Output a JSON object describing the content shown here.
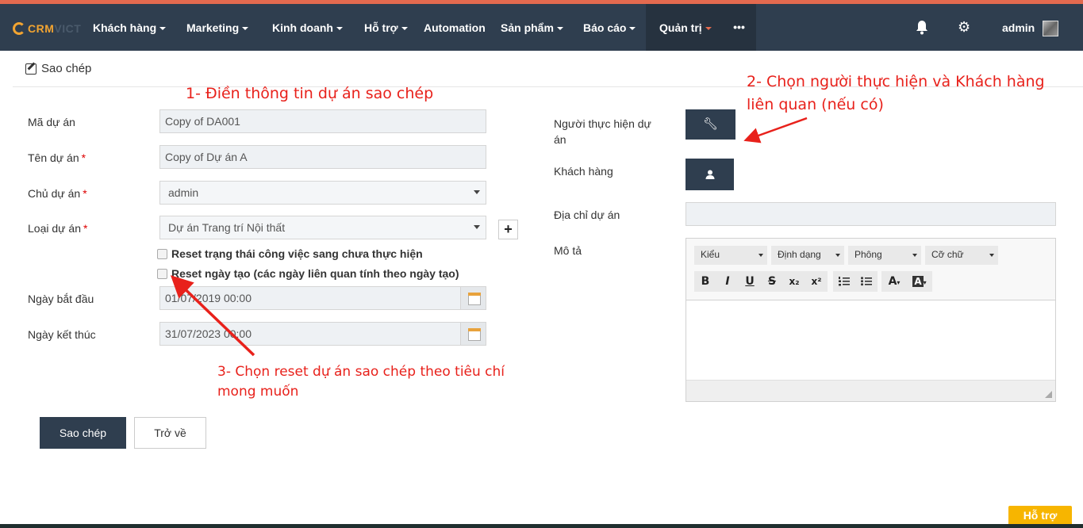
{
  "nav": {
    "logo_a": "CRM",
    "logo_b": "VICT",
    "items": [
      "Khách hàng",
      "Marketing",
      "Kinh doanh",
      "Hỗ trợ",
      "Automation",
      "Sản phẩm",
      "Báo cáo",
      "Quản trị"
    ],
    "more": "•••",
    "user": "admin"
  },
  "page": {
    "title": "Sao chép"
  },
  "form": {
    "code_label": "Mã dự án",
    "code_value": "Copy of DA001",
    "name_label": "Tên dự án",
    "name_value": "Copy of Dự án A",
    "owner_label": "Chủ dự án",
    "owner_value": "admin",
    "type_label": "Loại dự án",
    "type_value": "Dự án Trang trí Nội thất",
    "required_mark": "*",
    "reset_status_label": "Reset trạng thái công việc sang chưa thực hiện",
    "reset_date_label": "Reset ngày tạo (các ngày liên quan tính theo ngày tạo)",
    "start_label": "Ngày bắt đầu",
    "start_value": "01/07/2019 00:00",
    "end_label": "Ngày kết thúc",
    "end_value": "31/07/2023 00:00",
    "assignee_label": "Người thực hiện dự án",
    "customer_label": "Khách hàng",
    "address_label": "Địa chỉ dự án",
    "address_value": "",
    "desc_label": "Mô tả"
  },
  "editor": {
    "style": "Kiểu",
    "format": "Định dạng",
    "font": "Phông",
    "size": "Cỡ chữ",
    "buttons": [
      "B",
      "I",
      "U",
      "S",
      "x₂",
      "x²"
    ]
  },
  "actions": {
    "submit": "Sao chép",
    "back": "Trở về"
  },
  "annotations": {
    "a1": "1- Điền thông tin dự án sao chép",
    "a2": "2- Chọn người thực hiện và Khách hàng liên quan (nếu có)",
    "a3": "3- Chọn reset dự án sao chép theo tiêu chí mong muốn"
  },
  "support": "Hỗ trợ"
}
